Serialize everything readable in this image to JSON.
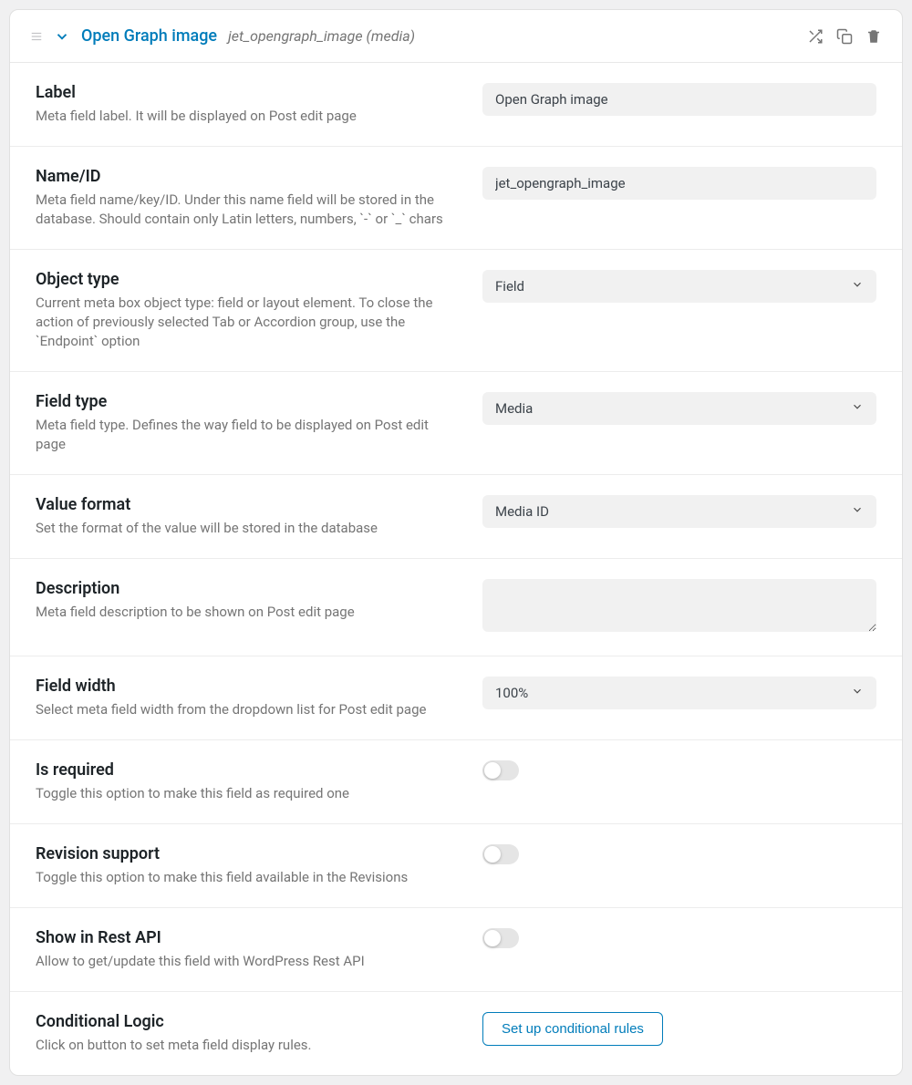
{
  "header": {
    "title": "Open Graph image",
    "subtitle": "jet_opengraph_image (media)"
  },
  "fields": {
    "label": {
      "title": "Label",
      "desc": "Meta field label. It will be displayed on Post edit page",
      "value": "Open Graph image"
    },
    "name_id": {
      "title": "Name/ID",
      "desc": "Meta field name/key/ID. Under this name field will be stored in the database. Should contain only Latin letters, numbers, `-` or `_` chars",
      "value": "jet_opengraph_image"
    },
    "object_type": {
      "title": "Object type",
      "desc": "Current meta box object type: field or layout element. To close the action of previously selected Tab or Accordion group, use the `Endpoint` option",
      "value": "Field"
    },
    "field_type": {
      "title": "Field type",
      "desc": "Meta field type. Defines the way field to be displayed on Post edit page",
      "value": "Media"
    },
    "value_format": {
      "title": "Value format",
      "desc": "Set the format of the value will be stored in the database",
      "value": "Media ID"
    },
    "description": {
      "title": "Description",
      "desc": "Meta field description to be shown on Post edit page",
      "value": ""
    },
    "field_width": {
      "title": "Field width",
      "desc": "Select meta field width from the dropdown list for Post edit page",
      "value": "100%"
    },
    "is_required": {
      "title": "Is required",
      "desc": "Toggle this option to make this field as required one"
    },
    "revision_support": {
      "title": "Revision support",
      "desc": "Toggle this option to make this field available in the Revisions"
    },
    "show_rest": {
      "title": "Show in Rest API",
      "desc": "Allow to get/update this field with WordPress Rest API"
    },
    "conditional": {
      "title": "Conditional Logic",
      "desc": "Click on button to set meta field display rules.",
      "button": "Set up conditional rules"
    }
  }
}
